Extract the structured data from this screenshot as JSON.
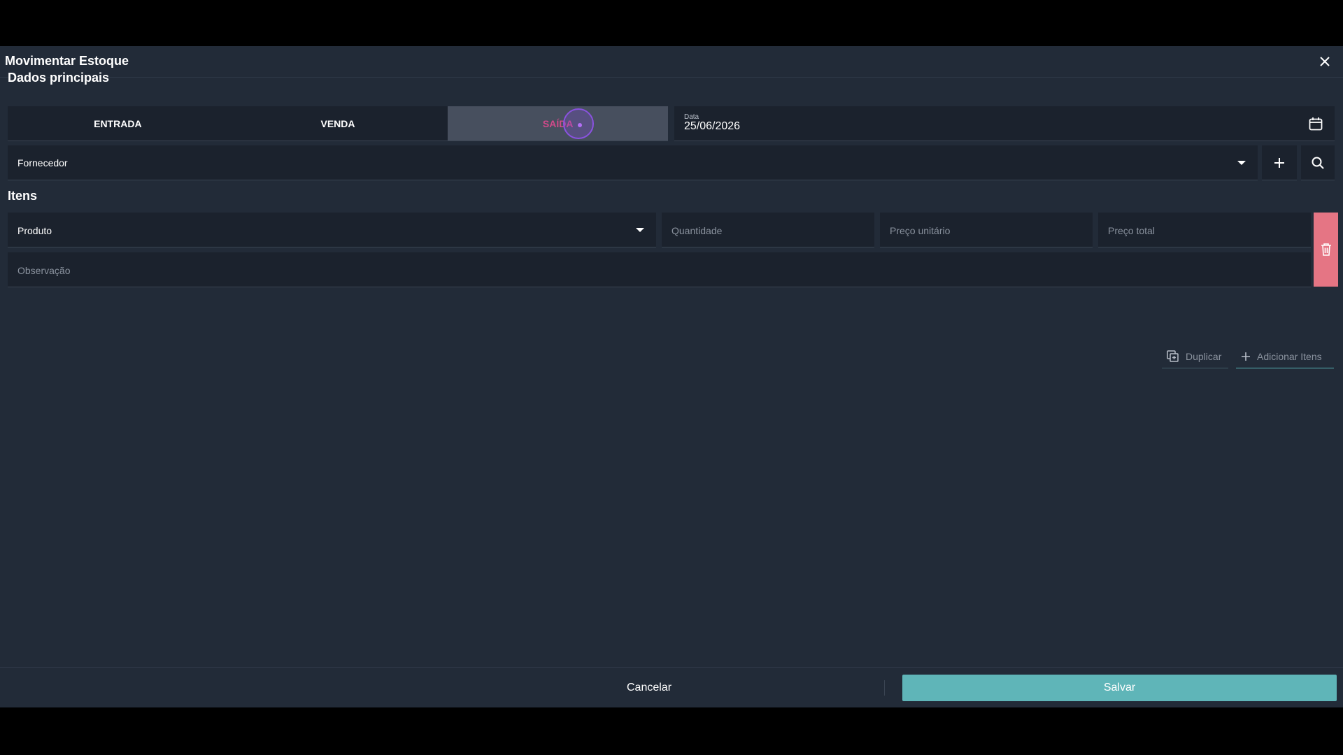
{
  "dialog": {
    "title": "Movimentar Estoque",
    "close_icon": "close-icon"
  },
  "main_section": {
    "title": "Dados principais",
    "movement_types": [
      {
        "label": "ENTRADA",
        "active": false
      },
      {
        "label": "VENDA",
        "active": false
      },
      {
        "label": "SAÍDA",
        "active": true
      }
    ],
    "date": {
      "label": "Data",
      "value": "25/06/2026",
      "icon": "calendar-icon"
    },
    "supplier": {
      "placeholder": "Fornecedor",
      "add_icon": "plus-icon",
      "search_icon": "search-icon"
    }
  },
  "items_section": {
    "title": "Itens",
    "product": {
      "placeholder": "Produto"
    },
    "quantity": {
      "placeholder": "Quantidade"
    },
    "unit_price": {
      "placeholder": "Preço unitário"
    },
    "total_price": {
      "placeholder": "Preço total"
    },
    "observation": {
      "placeholder": "Observação"
    },
    "delete_icon": "trash-icon",
    "duplicate_label": "Duplicar",
    "add_items_label": "Adicionar Itens"
  },
  "footer": {
    "cancel_label": "Cancelar",
    "save_label": "Salvar"
  },
  "colors": {
    "background": "#222b38",
    "field": "#1b222d",
    "active_toggle": "#474f5e",
    "active_toggle_text": "#d04a8a",
    "delete": "#e57584",
    "save": "#5fb5b8"
  }
}
